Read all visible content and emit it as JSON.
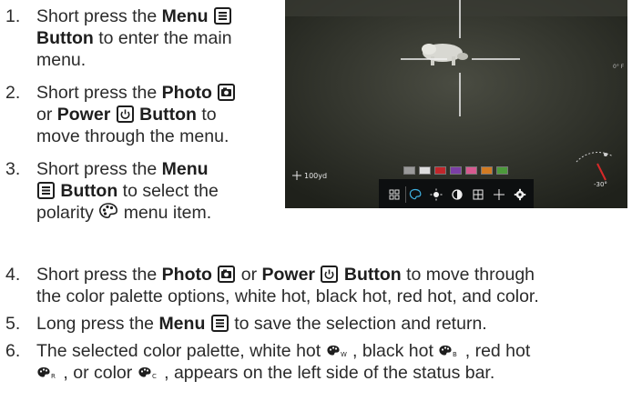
{
  "steps": [
    {
      "num": "1.",
      "lines": [
        [
          {
            "t": "Short press the "
          },
          {
            "b": "Menu"
          },
          {
            "t": " "
          },
          {
            "i": "menu-icon"
          }
        ],
        [
          {
            "b": "Button"
          },
          {
            "t": " to enter the main"
          }
        ],
        [
          {
            "t": "menu."
          }
        ]
      ]
    },
    {
      "num": "2.",
      "lines": [
        [
          {
            "t": "Short press the "
          },
          {
            "b": "Photo"
          },
          {
            "t": " "
          },
          {
            "i": "camera-icon"
          }
        ],
        [
          {
            "t": "or "
          },
          {
            "b": "Power"
          },
          {
            "t": " "
          },
          {
            "i": "power-icon"
          },
          {
            "t": " "
          },
          {
            "b": "Button"
          },
          {
            "t": " to"
          }
        ],
        [
          {
            "t": "move through the menu."
          }
        ]
      ]
    },
    {
      "num": "3.",
      "lines": [
        [
          {
            "t": "Short press the "
          },
          {
            "b": "Menu"
          }
        ],
        [
          {
            "i": "menu-icon"
          },
          {
            "t": " "
          },
          {
            "b": "Button"
          },
          {
            "t": " to select the"
          }
        ],
        [
          {
            "t": "polarity "
          },
          {
            "i": "palette-icon"
          },
          {
            "t": " menu item."
          }
        ]
      ]
    },
    {
      "num": "4.",
      "lines": [
        [
          {
            "t": "Short press the "
          },
          {
            "b": "Photo"
          },
          {
            "t": " "
          },
          {
            "i": "camera-icon"
          },
          {
            "t": " or "
          },
          {
            "b": "Power"
          },
          {
            "t": " "
          },
          {
            "i": "power-icon"
          },
          {
            "t": " "
          },
          {
            "b": "Button"
          },
          {
            "t": " to move through"
          }
        ],
        [
          {
            "t": "the color palette options, white hot, black hot, red hot, and color."
          }
        ]
      ]
    },
    {
      "num": "5.",
      "lines": [
        [
          {
            "t": "Long press the "
          },
          {
            "b": "Menu"
          },
          {
            "t": " "
          },
          {
            "i": "menu-icon"
          },
          {
            "t": " to save the selection and return."
          }
        ]
      ]
    },
    {
      "num": "6.",
      "lines": [
        [
          {
            "t": "The selected color palette, white hot "
          },
          {
            "p": "W"
          },
          {
            "t": " , black hot "
          },
          {
            "p": "B"
          },
          {
            "t": " , red hot"
          }
        ],
        [
          {
            "p": "R"
          },
          {
            "t": " , or color "
          },
          {
            "p": "C"
          },
          {
            "t": " , appears on the left side of the status bar."
          }
        ]
      ]
    }
  ],
  "screen": {
    "range_label": "100yd",
    "angle_label": "-30°",
    "side_readout": "0° F",
    "swatch_colors": [
      "#9a9a9a",
      "#dcdcdc",
      "#c0262b",
      "#7b3fa5",
      "#d65a8f",
      "#d17a22",
      "#4c9a3b"
    ],
    "status_icons": [
      "grid-icon",
      "palette-icon",
      "brightness-icon",
      "contrast-icon",
      "zoom-icon",
      "reticle-icon",
      "settings-icon"
    ]
  }
}
